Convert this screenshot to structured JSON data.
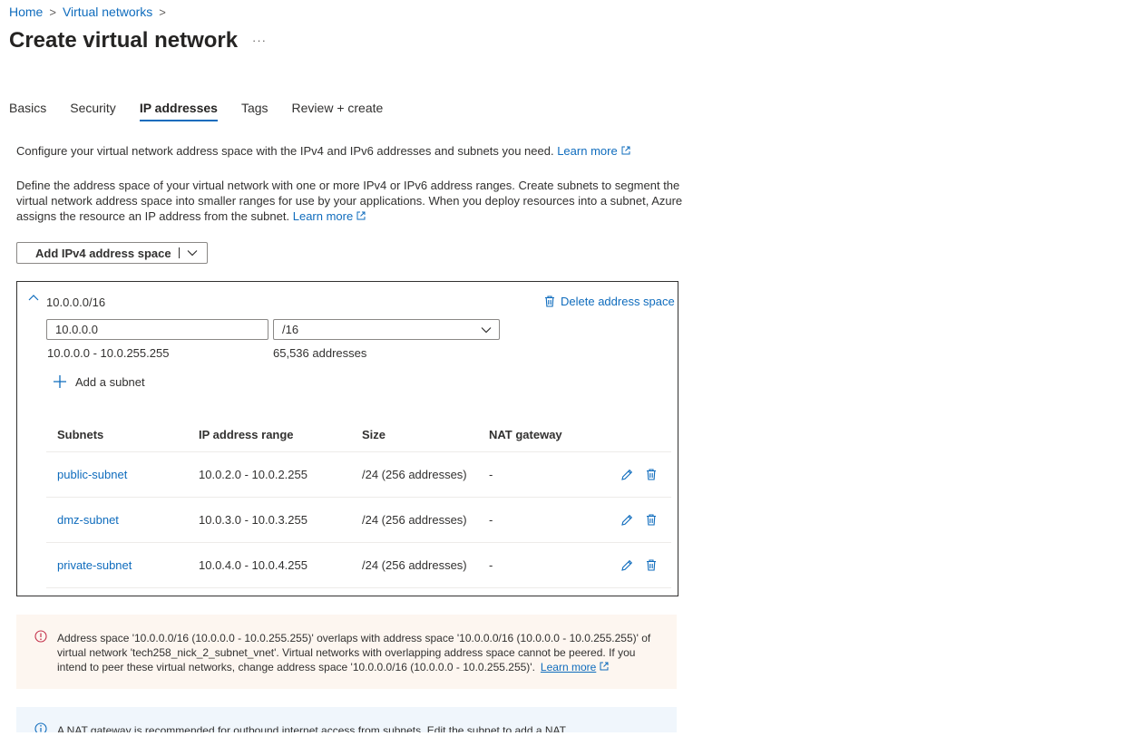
{
  "breadcrumb": {
    "home": "Home",
    "parent": "Virtual networks"
  },
  "page": {
    "title": "Create virtual network",
    "more": "···"
  },
  "tabs": [
    {
      "label": "Basics"
    },
    {
      "label": "Security"
    },
    {
      "label": "IP addresses"
    },
    {
      "label": "Tags"
    },
    {
      "label": "Review + create"
    }
  ],
  "intro": {
    "line1": "Configure your virtual network address space with the IPv4 and IPv6 addresses and subnets you need.",
    "line1_link": "Learn more",
    "line2": "Define the address space of your virtual network with one or more IPv4 or IPv6 address ranges. Create subnets to segment the virtual network address space into smaller ranges for use by your applications. When you deploy resources into a subnet, Azure assigns the resource an IP address from the subnet.",
    "line2_link": "Learn more"
  },
  "add_space_button": "Add IPv4 address space",
  "address_space": {
    "title": "10.0.0.0/16",
    "delete_label": "Delete address space",
    "ip_value": "10.0.0.0",
    "cidr_value": "/16",
    "range": "10.0.0.0 - 10.0.255.255",
    "count": "65,536 addresses",
    "add_subnet_label": "Add a subnet"
  },
  "subnet_table": {
    "headers": {
      "name": "Subnets",
      "range": "IP address range",
      "size": "Size",
      "nat": "NAT gateway"
    },
    "rows": [
      {
        "name": "public-subnet",
        "range": "10.0.2.0 - 10.0.2.255",
        "size": "/24 (256 addresses)",
        "nat": "-"
      },
      {
        "name": "dmz-subnet",
        "range": "10.0.3.0 - 10.0.3.255",
        "size": "/24 (256 addresses)",
        "nat": "-"
      },
      {
        "name": "private-subnet",
        "range": "10.0.4.0 - 10.0.4.255",
        "size": "/24 (256 addresses)",
        "nat": "-"
      }
    ]
  },
  "warning": {
    "text": "Address space '10.0.0.0/16 (10.0.0.0 - 10.0.255.255)' overlaps with address space '10.0.0.0/16 (10.0.0.0 - 10.0.255.255)' of virtual network 'tech258_nick_2_subnet_vnet'. Virtual networks with overlapping address space cannot be peered. If you intend to peer these virtual networks, change address space '10.0.0.0/16 (10.0.0.0 - 10.0.255.255)'.",
    "link": "Learn more"
  },
  "info": {
    "text": "A NAT gateway is recommended for outbound internet access from subnets. Edit the subnet to add a NAT"
  },
  "colors": {
    "accent": "#0f6cbd",
    "warning_bg": "#fdf6f0",
    "warning_icon": "#c4314b",
    "info_bg": "#f0f6fc"
  }
}
